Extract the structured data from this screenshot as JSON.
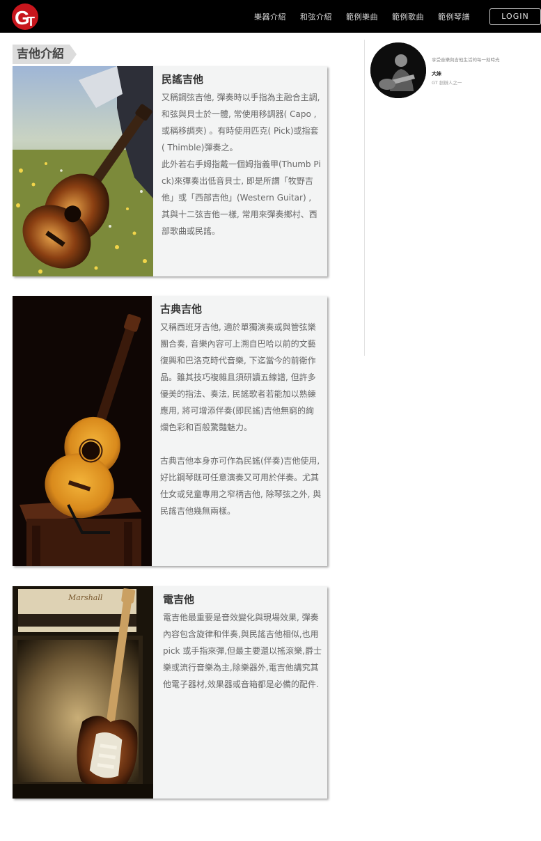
{
  "header": {
    "logo_text": "GT",
    "nav": [
      "樂器介紹",
      "和弦介紹",
      "範例樂曲",
      "範例歌曲",
      "範例琴譜"
    ],
    "login_label": "LOGIN"
  },
  "section": {
    "title": "吉他介紹"
  },
  "cards": [
    {
      "title": "民謠吉他",
      "paragraphs": [
        "又稱鋼弦吉他, 彈奏時以手指為主融合主調, 和弦與貝士於一體, 常使用移調器( Capo , 或稱移調夾) 。有時使用匹克( Pick)或指套( Thimble)彈奏之。",
        "此外若右手姆指戴一個姆指義甲(Thumb Pick)來彈奏出低音貝士, 即是所謂「牧野吉他」或「西部吉他」(Western Guitar) , 其與十二弦吉他一樣, 常用來彈奏鄉村、西部歌曲或民謠。"
      ]
    },
    {
      "title": "古典吉他",
      "paragraphs": [
        "又稱西班牙吉他, 適於單獨演奏或與管弦樂團合奏, 音樂內容可上溯自巴哈以前的文藝復興和巴洛克時代音樂, 下迄當今的前衛作品。雖其技巧複雜且須研讀五線譜, 但許多優美的指法、奏法, 民謠歌者若能加以熟練應用, 將可增添伴奏(即民謠)吉他無窮的絢爛色彩和百般驚豔魅力。",
        "古典吉他本身亦可作為民謠(伴奏)吉他使用, 好比鋼琴既可任意演奏又可用於伴奏。尤其仕女或兒童專用之窄柄吉他, 除琴弦之外, 與民謠吉他幾無兩樣。"
      ]
    },
    {
      "title": "電吉他",
      "paragraphs": [
        "電吉他最重要是音效變化與現場效果, 彈奏內容包含旋律和伴奏,與民謠吉他相似,也用pick 或手指來彈,但最主要還以搖滾樂,爵士樂或流行音樂為主,除樂器外,電吉他講究其他電子器材,效果器或音箱都是必備的配件."
      ]
    }
  ],
  "profile": {
    "quote": "享受音樂與吉他生活的每一刻時光",
    "name": "大妹",
    "role": "GT 創辦人之一"
  }
}
